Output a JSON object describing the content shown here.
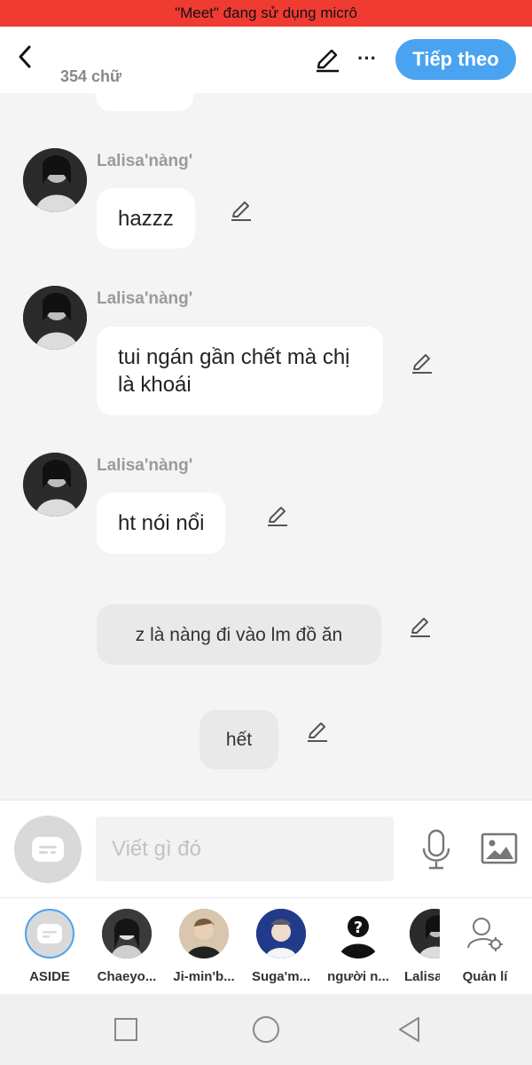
{
  "status_bar": {
    "text": "\"Meet\" đang sử dụng micrô"
  },
  "header": {
    "word_count": "354 chữ",
    "next_label": "Tiếp theo"
  },
  "messages": [
    {
      "sender": "Lalisa'nàng'",
      "text": "hazzz"
    },
    {
      "sender": "Lalisa'nàng'",
      "text": "tui ngán gần chết mà chị là khoái"
    },
    {
      "sender": "Lalisa'nàng'",
      "text": "ht nói nổi"
    },
    {
      "text": "z là nàng đi vào lm đồ ăn"
    },
    {
      "text": "hết"
    }
  ],
  "composer": {
    "placeholder": "Viết gì đó"
  },
  "characters": [
    {
      "name": "ASIDE"
    },
    {
      "name": "Chaeyo..."
    },
    {
      "name": "Ji-min'b..."
    },
    {
      "name": "Suga'm..."
    },
    {
      "name": "người n..."
    },
    {
      "name": "Lalisa"
    },
    {
      "name": "Quản lí"
    }
  ],
  "colors": {
    "status_bar": "#f03b33",
    "accent": "#4aa3f0",
    "bubble": "#ffffff",
    "narration_bubble": "#e9e9e9"
  }
}
